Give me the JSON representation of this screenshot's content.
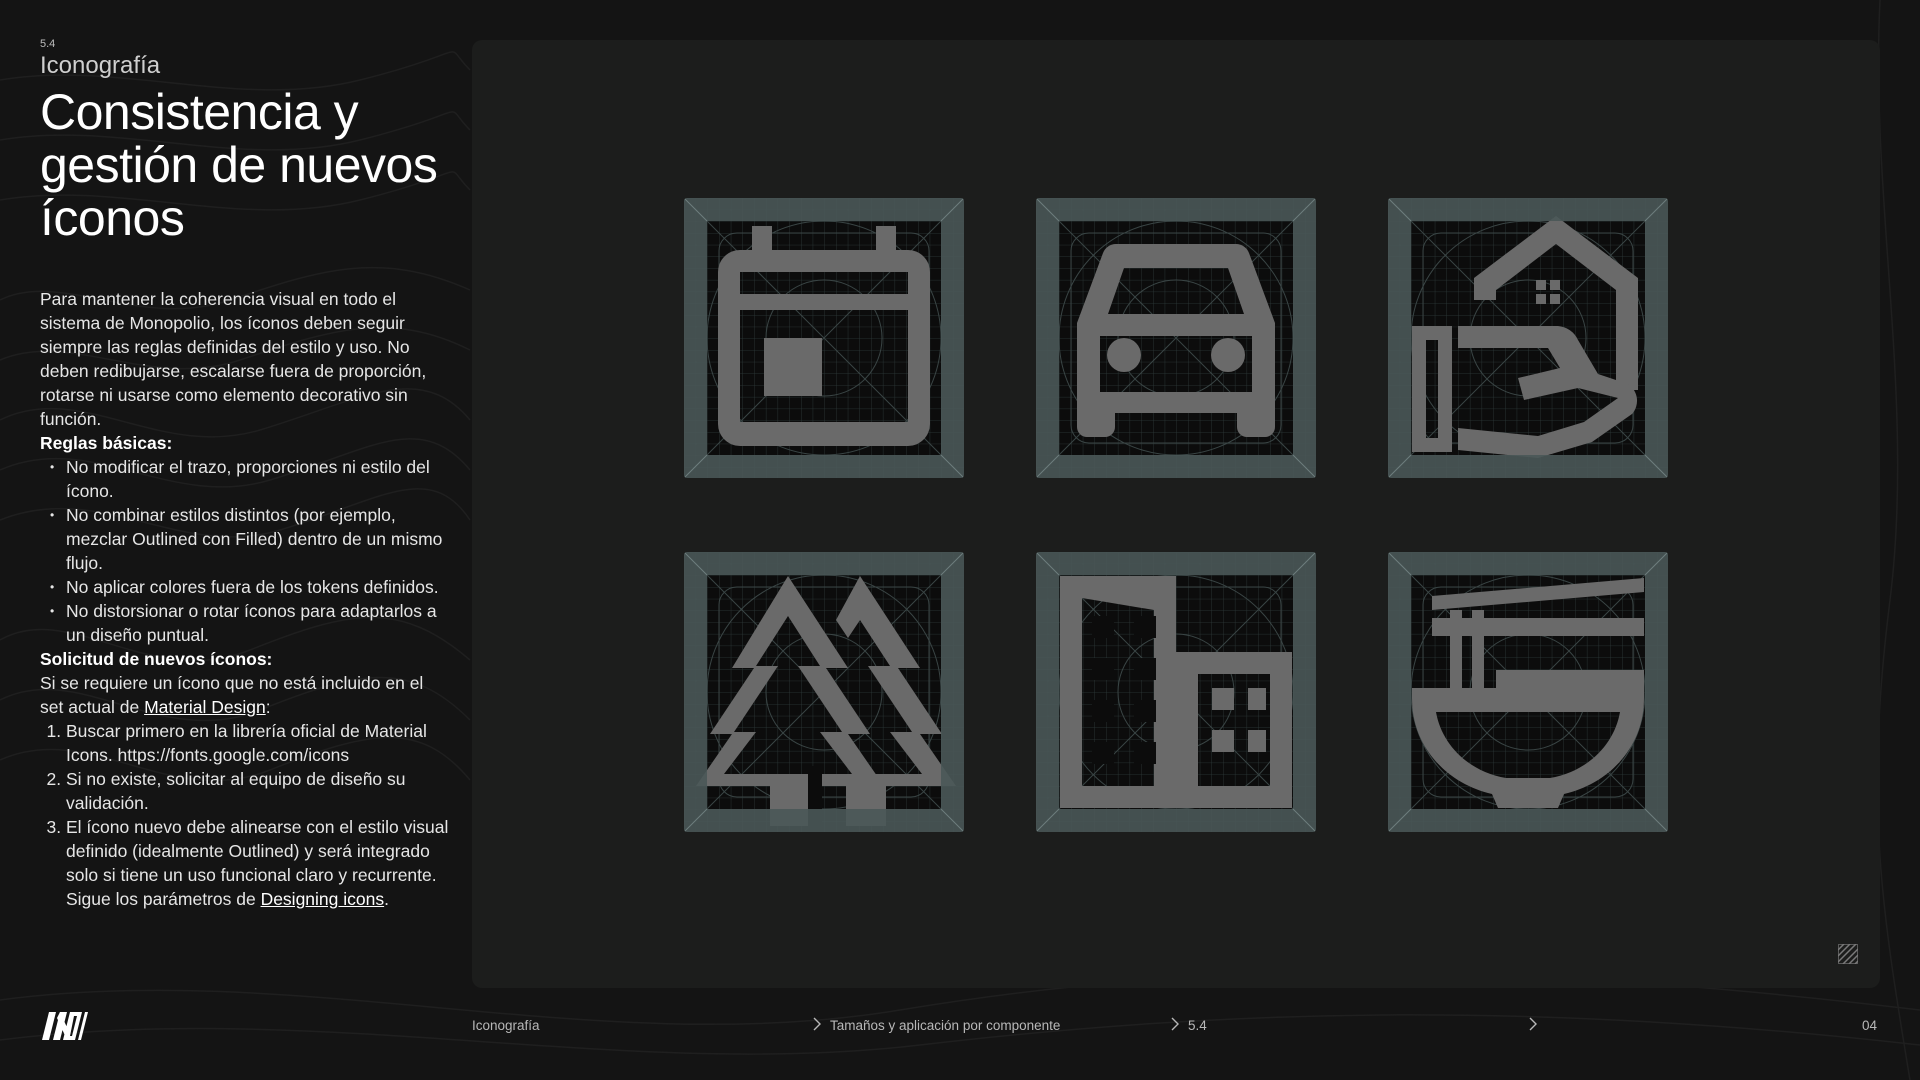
{
  "header": {
    "section_number": "5.4",
    "section_name": "Iconografía",
    "title": "Consistencia y gestión de nuevos íconos"
  },
  "body": {
    "intro": "Para mantener la coherencia visual en todo el sistema de Monopolio, los íconos deben seguir siempre las reglas definidas del estilo y uso. No deben redibujarse, escalarse fuera de proporción, rotarse ni usarse como elemento decorativo sin función.",
    "rules_heading": "Reglas básicas:",
    "rules": [
      "No modificar el trazo, proporciones ni estilo del ícono.",
      "No combinar estilos distintos (por ejemplo, mezclar Outlined con Filled) dentro de un mismo flujo.",
      "No aplicar colores fuera de los tokens definidos.",
      "No distorsionar o rotar íconos para adaptarlos a un diseño puntual."
    ],
    "request_heading": "Solicitud de nuevos íconos:",
    "request_text_before": "Si se requiere un ícono que no está incluido en el set actual de ",
    "request_link": "Material Design",
    "request_text_after": ":",
    "steps": {
      "step1": "Buscar primero en la librería oficial de Material Icons. https://fonts.google.com/icons",
      "step2": "Si no existe, solicitar al equipo de diseño su validación.",
      "step3_before": "El ícono nuevo debe alinearse con el estilo visual definido (idealmente Outlined) y será integrado solo si tiene un uso funcional claro y recurrente. Sigue los parámetros de ",
      "step3_link": "Designing icons",
      "step3_after": "."
    }
  },
  "icons": [
    {
      "name": "calendar-icon"
    },
    {
      "name": "car-icon"
    },
    {
      "name": "real-estate-hand-icon"
    },
    {
      "name": "forest-icon"
    },
    {
      "name": "apartment-icon"
    },
    {
      "name": "ramen-dining-icon"
    }
  ],
  "footer": {
    "breadcrumb_1": "Iconografía",
    "breadcrumb_2": "Tamaños y aplicación por componente",
    "breadcrumb_3": "5.4",
    "page_number": "04"
  },
  "colors": {
    "background": "#141414",
    "panel": "#1c1d1c",
    "keyline_frame": "#4a5858",
    "icon_glyph": "#6a6a6a"
  }
}
